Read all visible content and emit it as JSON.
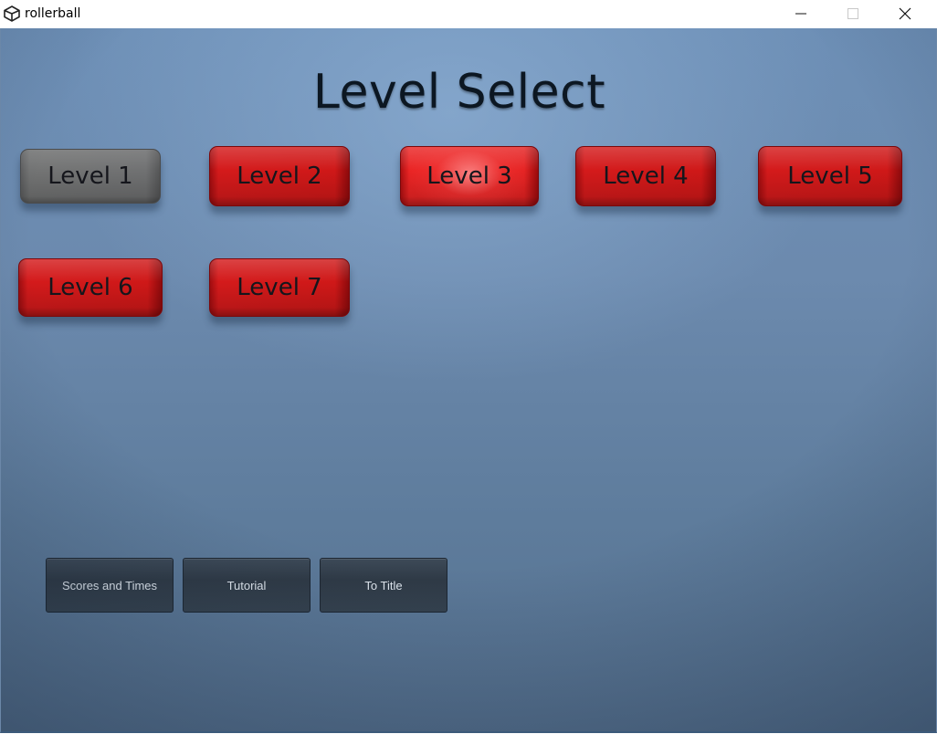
{
  "window": {
    "title": "rollerball"
  },
  "scene": {
    "heading": "Level Select",
    "levels": [
      {
        "label": "Level 1",
        "state": "locked-gray"
      },
      {
        "label": "Level 2",
        "state": "available"
      },
      {
        "label": "Level 3",
        "state": "highlighted"
      },
      {
        "label": "Level 4",
        "state": "available"
      },
      {
        "label": "Level 5",
        "state": "available"
      },
      {
        "label": "Level 6",
        "state": "available"
      },
      {
        "label": "Level 7",
        "state": "available"
      }
    ],
    "buttons": {
      "scores": "Scores and Times",
      "tutorial": "Tutorial",
      "title": "To Title"
    }
  },
  "colors": {
    "level_red": "#d41a1b",
    "level_gray": "#737474",
    "background": "#6c8aae",
    "menu_button": "#35424f"
  },
  "icons": {
    "app": "unity-logo-icon",
    "minimize": "minimize-icon",
    "maximize": "maximize-icon",
    "close": "close-icon"
  }
}
